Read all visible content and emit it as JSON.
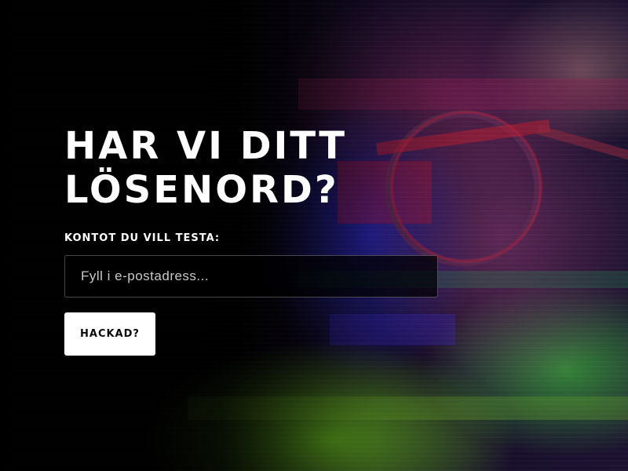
{
  "hero": {
    "headline": "HAR VI DITT LÖSENORD?"
  },
  "form": {
    "label": "KONTOT DU VILL TESTA:",
    "email_placeholder": "Fyll i e-postadress...",
    "email_value": "",
    "submit_label": "HACKAD?"
  },
  "colors": {
    "text": "#ffffff",
    "button_background": "#ffffff",
    "button_text": "#0a0a0a",
    "input_background": "#000000"
  }
}
